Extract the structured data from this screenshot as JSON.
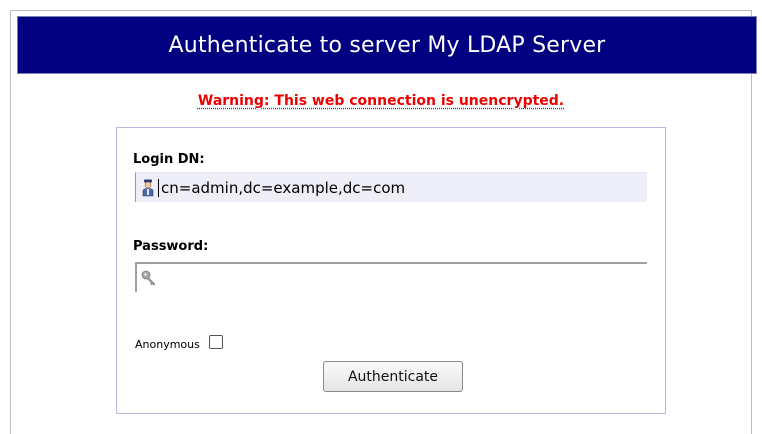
{
  "header": {
    "title": "Authenticate to server My LDAP Server"
  },
  "warning": {
    "text": "Warning: This web connection is unencrypted."
  },
  "form": {
    "login_dn_label": "Login DN:",
    "login_dn_value": "cn=admin,dc=example,dc=com",
    "password_label": "Password:",
    "password_value": "",
    "anonymous_label": "Anonymous",
    "anonymous_checked": false,
    "authenticate_label": "Authenticate"
  },
  "icons": {
    "login_dn": "user-icon",
    "password": "key-icon"
  },
  "colors": {
    "title_bar": "#000080",
    "warning": "#ee0000",
    "box_border": "#b8b8e0"
  }
}
